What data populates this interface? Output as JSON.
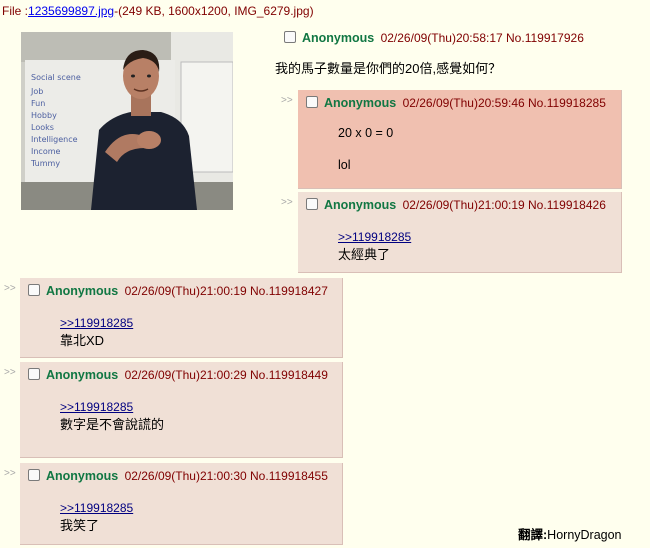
{
  "file": {
    "prefix": "File :",
    "name": "1235699897.jpg",
    "meta": "-(249 KB, 1600x1200, IMG_6279.jpg)"
  },
  "op": {
    "name": "Anonymous",
    "datetime": "02/26/09(Thu)20:58:17",
    "no": "No.119917926",
    "message": "我的馬子數量是你們的20倍,感覺如何？"
  },
  "replies": [
    {
      "name": "Anonymous",
      "datetime": "02/26/09(Thu)20:59:46",
      "no": "No.119918285",
      "line1": "20 x 0 = 0",
      "line2": "lol"
    },
    {
      "name": "Anonymous",
      "datetime": "02/26/09(Thu)21:00:19",
      "no": "No.119918426",
      "quote": ">>119918285",
      "text": "太經典了"
    },
    {
      "name": "Anonymous",
      "datetime": "02/26/09(Thu)21:00:19",
      "no": "No.119918427",
      "quote": ">>119918285",
      "text": "靠北XD"
    },
    {
      "name": "Anonymous",
      "datetime": "02/26/09(Thu)21:00:29",
      "no": "No.119918449",
      "quote": ">>119918285",
      "text": "數字是不會說謊的"
    },
    {
      "name": "Anonymous",
      "datetime": "02/26/09(Thu)21:00:30",
      "no": "No.119918455",
      "quote": ">>119918285",
      "text": "我笑了"
    }
  ],
  "arrow": ">>",
  "credit": {
    "label": "翻譯:",
    "name": "HornyDragon"
  },
  "whiteboard_lines": [
    "Social scene",
    "Job",
    "Fun",
    "Hobby",
    "Looks",
    "Intelligence",
    "Income",
    "Tummy"
  ],
  "colors": {
    "background": "#ffffee",
    "reply": "#f0e0d6",
    "highlight": "#f0c0b0",
    "name": "#117743"
  }
}
